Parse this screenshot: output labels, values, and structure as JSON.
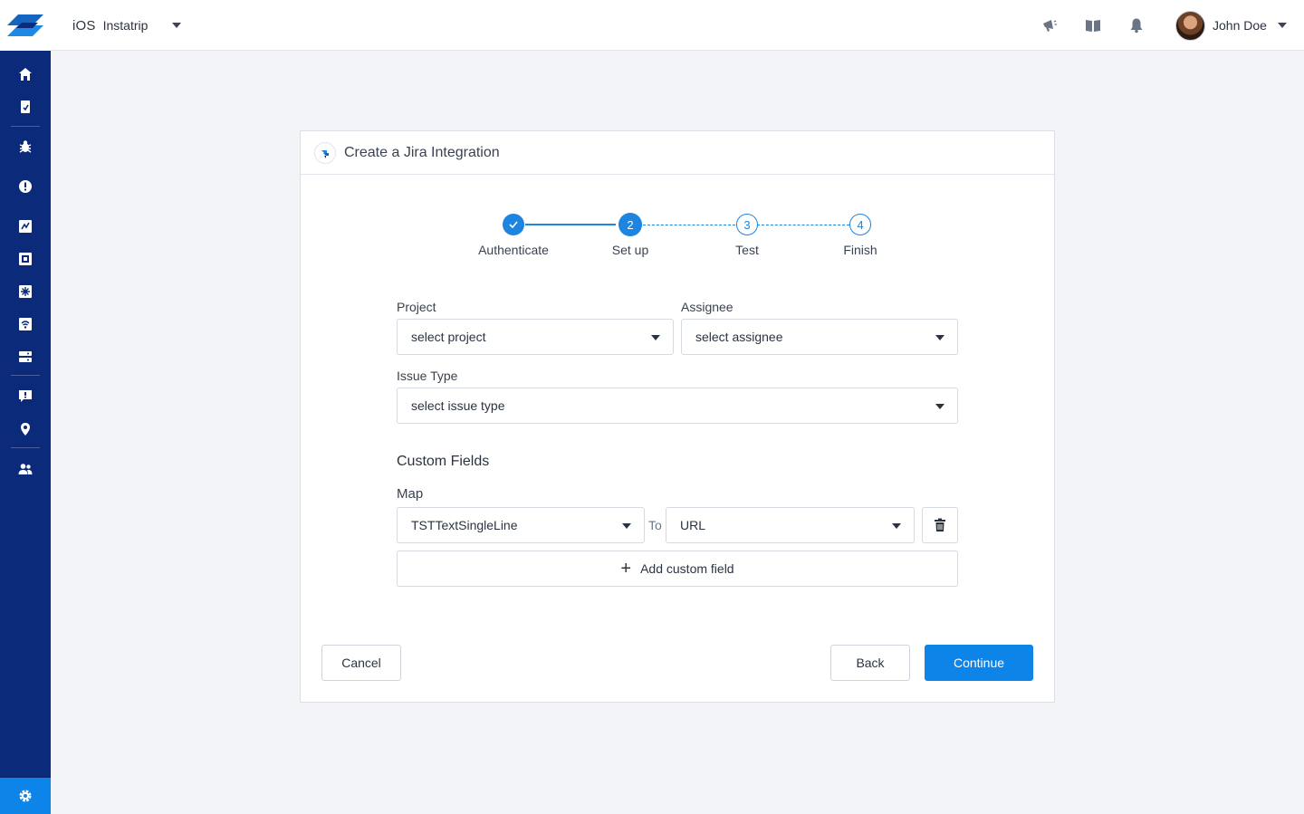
{
  "topbar": {
    "platform": "iOS",
    "app_name": "Instatrip",
    "user_name": "John Doe",
    "icons": [
      "announcement-icon",
      "docs-book-icon",
      "notifications-bell-icon"
    ]
  },
  "sidebar": {
    "icons": [
      "home-icon",
      "reports-icon",
      "bugs-icon",
      "crashes-icon",
      "surveys-icon",
      "feature-requests-icon",
      "releases-icon",
      "network-icon",
      "apm-icon",
      "chat-icon",
      "location-icon",
      "team-icon",
      "settings-icon"
    ]
  },
  "card": {
    "title": "Create a Jira Integration"
  },
  "stepper": {
    "steps": [
      {
        "label": "Authenticate",
        "number": "1",
        "state": "complete"
      },
      {
        "label": "Set up",
        "number": "2",
        "state": "active"
      },
      {
        "label": "Test",
        "number": "3",
        "state": "pending"
      },
      {
        "label": "Finish",
        "number": "4",
        "state": "pending"
      }
    ]
  },
  "form": {
    "project_label": "Project",
    "project_value": "select project",
    "assignee_label": "Assignee",
    "assignee_value": "select assignee",
    "issue_type_label": "Issue Type",
    "issue_type_value": "select issue type",
    "custom_fields_title": "Custom Fields",
    "map_label": "Map",
    "map_from_value": "TSTTextSingleLine",
    "to_label": "To",
    "map_to_value": "URL",
    "add_custom_field": "Add custom field"
  },
  "footer": {
    "cancel": "Cancel",
    "back": "Back",
    "continue": "Continue"
  },
  "colors": {
    "sidebar": "#0b2a7a",
    "accent": "#1d84e0",
    "primary_button": "#0d84e8"
  }
}
